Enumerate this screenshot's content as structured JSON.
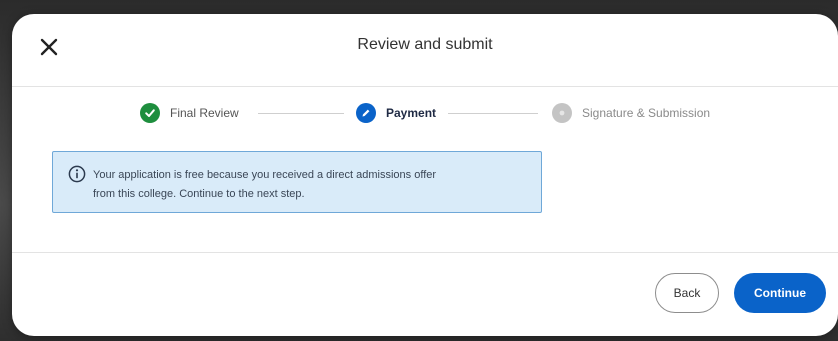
{
  "dialog": {
    "title": "Review and submit"
  },
  "steps": [
    {
      "label": "Final Review",
      "status": "complete"
    },
    {
      "label": "Payment",
      "status": "active"
    },
    {
      "label": "Signature & Submission",
      "status": "upcoming"
    }
  ],
  "info_banner": {
    "line1": "Your application is free because you received a direct admissions offer",
    "line2": "from this college. Continue to the next step."
  },
  "footer": {
    "back_label": "Back",
    "continue_label": "Continue"
  },
  "colors": {
    "complete": "#1e8e3e",
    "active": "#0a63c9",
    "upcoming": "#c4c4c4",
    "banner_bg": "#d9ebf9",
    "banner_border": "#6fa8d8"
  },
  "icons": {
    "close": "close-icon",
    "complete": "checkmark-icon",
    "active": "pencil-icon",
    "upcoming": "step-number-icon",
    "info": "info-icon"
  }
}
